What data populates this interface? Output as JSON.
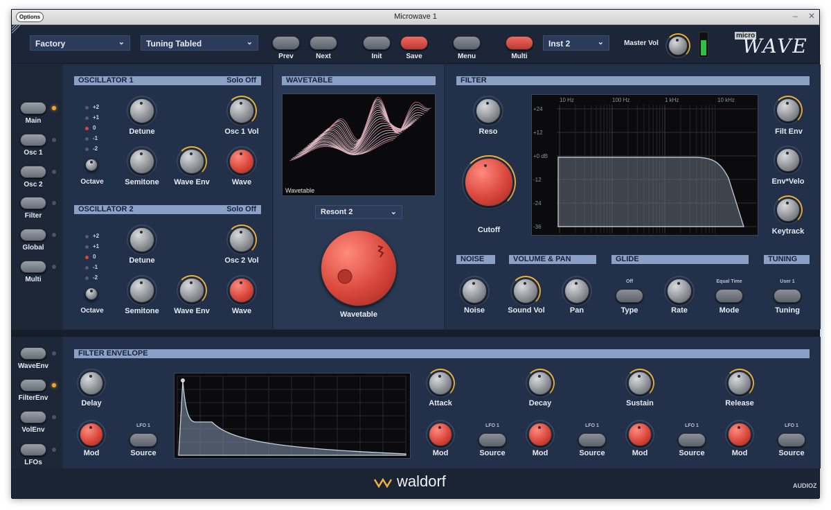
{
  "window": {
    "title": "Microwave 1",
    "options_label": "Options",
    "min": "–",
    "close": "✕"
  },
  "topbar": {
    "bank": "Factory",
    "patch": "Tuning Tabled",
    "prev": "Prev",
    "next": "Next",
    "init": "Init",
    "save": "Save",
    "menu": "Menu",
    "multi": "Multi",
    "inst": "Inst 2",
    "master_vol": "Master Vol",
    "logo_micro": "micro",
    "logo_wave": "WAVE"
  },
  "sidebar": {
    "top": [
      "Main",
      "Osc 1",
      "Osc 2",
      "Filter",
      "Global",
      "Multi"
    ],
    "bottom": [
      "WaveEnv",
      "FilterEnv",
      "VolEnv",
      "LFOs"
    ]
  },
  "osc1": {
    "title": "OSCILLATOR 1",
    "solo": "Solo Off",
    "octaves": [
      "+2",
      "+1",
      "0",
      "-1",
      "-2"
    ],
    "octave": "Octave",
    "detune": "Detune",
    "vol": "Osc 1 Vol",
    "semitone": "Semitone",
    "wave_env": "Wave Env",
    "wave": "Wave"
  },
  "osc2": {
    "title": "OSCILLATOR 2",
    "solo": "Solo Off",
    "octaves": [
      "+2",
      "+1",
      "0",
      "-1",
      "-2"
    ],
    "octave": "Octave",
    "detune": "Detune",
    "vol": "Osc 2 Vol",
    "semitone": "Semitone",
    "wave_env": "Wave Env",
    "wave": "Wave"
  },
  "wavetable": {
    "title": "WAVETABLE",
    "screen_label": "Wavetable",
    "selected": "Resont 2",
    "knob_label": "Wavetable"
  },
  "filter": {
    "title": "FILTER",
    "reso": "Reso",
    "cutoff": "Cutoff",
    "filt_env": "Filt Env",
    "env_velo": "Env*Velo",
    "keytrack": "Keytrack",
    "db_ticks": [
      "+24",
      "+12",
      "+0 dB",
      "-12",
      "-24",
      "-36"
    ],
    "freq_ticks": [
      "10 Hz",
      "100 Hz",
      "1 kHz",
      "10 kHz"
    ]
  },
  "noise": {
    "title": "NOISE",
    "noise": "Noise"
  },
  "volpan": {
    "title": "VOLUME & PAN",
    "sound_vol": "Sound Vol",
    "pan": "Pan"
  },
  "glide": {
    "title": "GLIDE",
    "type_value": "Off",
    "type": "Type",
    "rate": "Rate",
    "mode_value": "Equal Time",
    "mode": "Mode"
  },
  "tuning": {
    "title": "TUNING",
    "value": "User 1",
    "tuning": "Tuning"
  },
  "filter_env": {
    "title": "FILTER ENVELOPE",
    "delay": "Delay",
    "mod": "Mod",
    "lfo": "LFO 1",
    "source": "Source",
    "attack": "Attack",
    "decay": "Decay",
    "sustain": "Sustain",
    "release": "Release"
  },
  "brand": "waldorf",
  "watermark": "AUDIOZ",
  "colors": {
    "accent": "#f0b23c",
    "red": "#d9473c",
    "panel": "#28364f",
    "header": "#8aa0c4"
  }
}
